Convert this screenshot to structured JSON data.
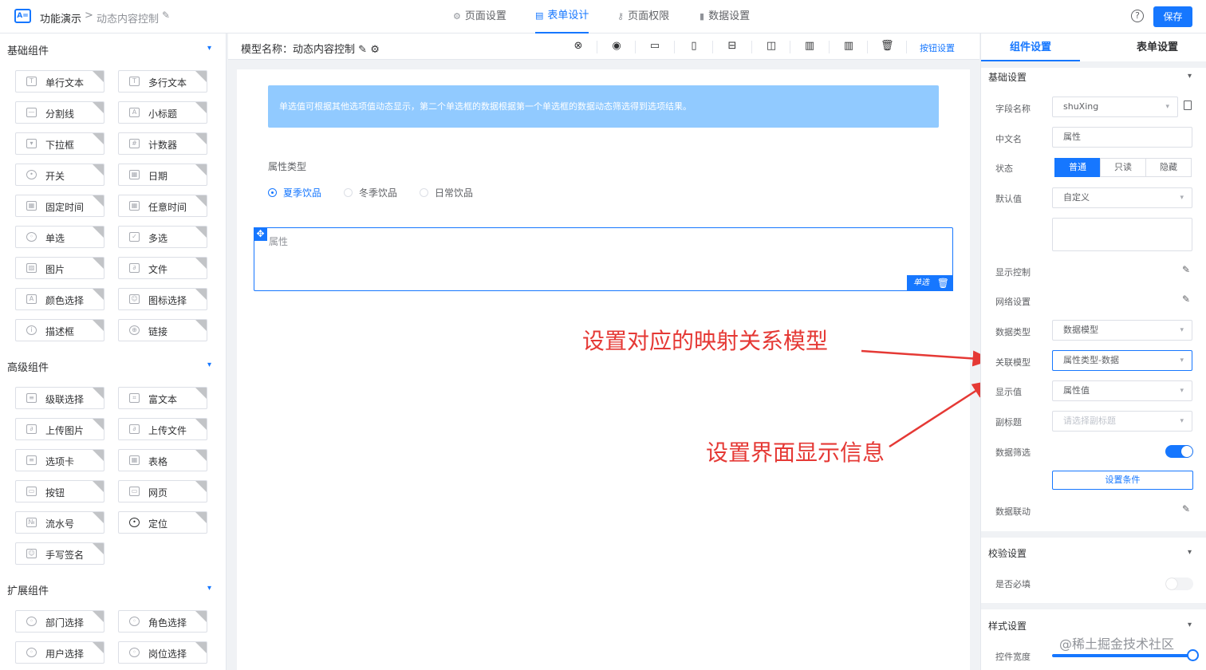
{
  "topbar": {
    "app_title": "功能演示",
    "breadcrumb_sep": ">",
    "breadcrumb_current": "动态内容控制",
    "tabs": [
      {
        "label": "页面设置",
        "icon": "gear-icon",
        "active": false
      },
      {
        "label": "表单设计",
        "icon": "document-icon",
        "active": true
      },
      {
        "label": "页面权限",
        "icon": "key-icon",
        "active": false
      },
      {
        "label": "数据设置",
        "icon": "bar-chart-icon",
        "active": false
      }
    ],
    "help": "?",
    "save_label": "保存"
  },
  "left": {
    "basic_title": "基础组件",
    "basic_items": [
      "单行文本",
      "多行文本",
      "分割线",
      "小标题",
      "下拉框",
      "计数器",
      "开关",
      "日期",
      "固定时间",
      "任意时间",
      "单选",
      "多选",
      "图片",
      "文件",
      "颜色选择",
      "图标选择",
      "描述框",
      "链接"
    ],
    "advanced_title": "高级组件",
    "advanced_items": [
      "级联选择",
      "富文本",
      "上传图片",
      "上传文件",
      "选项卡",
      "表格",
      "按钮",
      "网页",
      "流水号",
      "定位",
      "手写签名"
    ],
    "extension_title": "扩展组件",
    "extension_items": [
      "部门选择",
      "角色选择",
      "用户选择",
      "岗位选择"
    ]
  },
  "center": {
    "model_name_label": "模型名称：",
    "model_name": "动态内容控制",
    "button_settings": "按钮设置",
    "notice": "单选值可根据其他选项值动态显示，第二个单选框的数据根据第一个单选框的数据动态筛选得到选项结果。",
    "radio_label": "属性类型",
    "radio_options": [
      "夏季饮品",
      "冬季饮品",
      "日常饮品"
    ],
    "field_label": "属性",
    "field_tag": "单选"
  },
  "annotations": {
    "mapping": "设置对应的映射关系模型",
    "display": "设置界面显示信息"
  },
  "right": {
    "tab_component": "组件设置",
    "tab_form": "表单设置",
    "basic_section": "基础设置",
    "field_name_label": "字段名称",
    "field_name_value": "shuXing",
    "cn_name_label": "中文名",
    "cn_name_value": "属性",
    "state_label": "状态",
    "state_options": [
      "普通",
      "只读",
      "隐藏"
    ],
    "default_label": "默认值",
    "default_value": "自定义",
    "display_control_label": "显示控制",
    "grid_settings_label": "网络设置",
    "data_type_label": "数据类型",
    "data_type_value": "数据模型",
    "related_model_label": "关联模型",
    "related_model_value": "属性类型-数据",
    "display_value_label": "显示值",
    "display_value_value": "属性值",
    "subtitle_label": "副标题",
    "subtitle_placeholder": "请选择副标题",
    "data_filter_label": "数据筛选",
    "set_condition_label": "设置条件",
    "data_link_label": "数据联动",
    "validation_section": "校验设置",
    "required_label": "是否必填",
    "style_section": "样式设置",
    "control_width_label": "控件宽度"
  },
  "watermark": "@稀土掘金技术社区",
  "colors": {
    "primary": "#1677ff",
    "annotation": "#e53935",
    "notice": "#91caff"
  }
}
